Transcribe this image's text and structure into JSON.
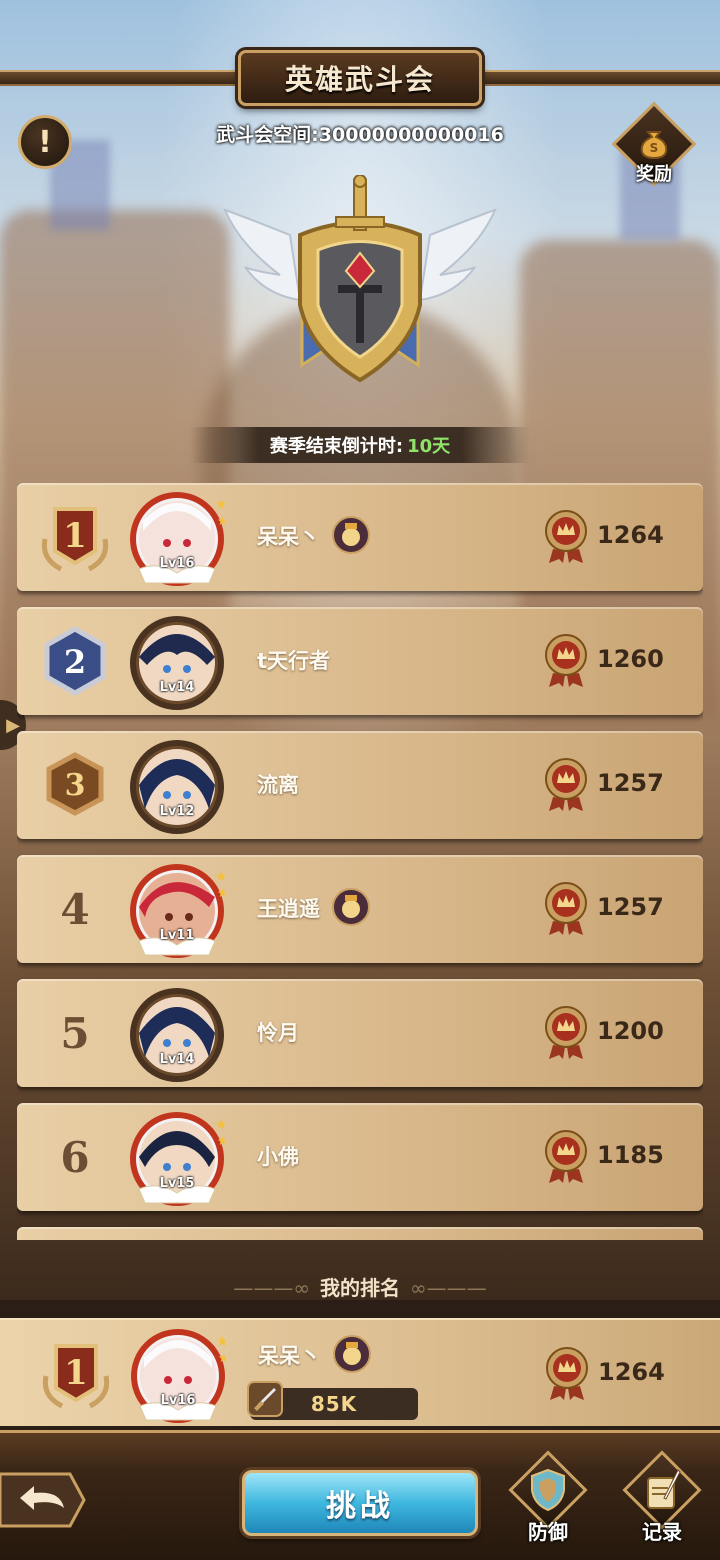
{
  "header": {
    "title": "英雄武斗会",
    "room": "武斗会空间:30000000000016",
    "info_icon": "exclamation-icon",
    "reward_label": "奖励"
  },
  "season": {
    "label": "赛季结束倒计时:",
    "days": "10天"
  },
  "ranking": [
    {
      "rank": "1",
      "name": "呆呆丶",
      "level": "Lv16",
      "score": "1264",
      "guild": true,
      "frame": "red"
    },
    {
      "rank": "2",
      "name": "t天行者",
      "level": "Lv14",
      "score": "1260",
      "guild": false,
      "frame": "brown"
    },
    {
      "rank": "3",
      "name": "流离",
      "level": "Lv12",
      "score": "1257",
      "guild": false,
      "frame": "brown"
    },
    {
      "rank": "4",
      "name": "王逍遥",
      "level": "Lv11",
      "score": "1257",
      "guild": true,
      "frame": "red"
    },
    {
      "rank": "5",
      "name": "怜月",
      "level": "Lv14",
      "score": "1200",
      "guild": false,
      "frame": "brown"
    },
    {
      "rank": "6",
      "name": "小佛",
      "level": "Lv15",
      "score": "1185",
      "guild": false,
      "frame": "red"
    }
  ],
  "my_rank": {
    "section_title": "我的排名",
    "rank": "1",
    "name": "呆呆丶",
    "level": "Lv16",
    "power": "85K",
    "score": "1264"
  },
  "bottom": {
    "challenge_label": "挑战",
    "defense_label": "防御",
    "record_label": "记录"
  },
  "colors": {
    "accent_gold": "#c9a062",
    "days_green": "#8fe36a",
    "challenge_blue": "#3fb7df"
  }
}
